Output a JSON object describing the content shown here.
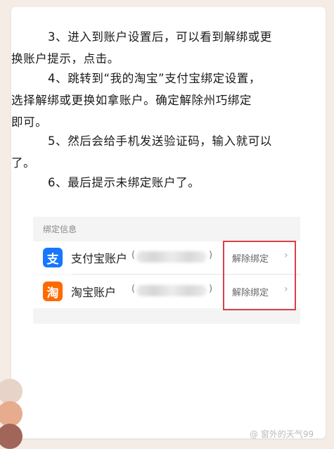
{
  "steps": {
    "s3_line1": "3、进入到账户设置后，可以看到解绑或更",
    "s3_line2": "换账户提示，点击。",
    "s4_line1": "4、跳转到“我的淘宝”支付宝绑定设置，",
    "s4_line2": "选择解绑或更换如拿账户。确定解除州巧绑定",
    "s4_line3": "即可。",
    "s5_line1": "5、然后会给手机发送验证码，输入就可以",
    "s5_line2": "了。",
    "s6_line1": "6、最后提示未绑定账户了。"
  },
  "screenshot": {
    "section_title": "绑定信息",
    "rows": [
      {
        "icon": "alipay-icon",
        "icon_glyph": "支",
        "icon_color": "#1677ff",
        "label": "支付宝账户",
        "unbind": "解除绑定"
      },
      {
        "icon": "taobao-icon",
        "icon_glyph": "淘",
        "icon_color": "#ff6a00",
        "label": "淘宝账户",
        "unbind": "解除绑定"
      }
    ],
    "highlight_color": "#d9404a"
  },
  "decoration_colors": [
    "#e7d3c8",
    "#e7ab8e",
    "#a1655a"
  ],
  "watermark": "@ 窗外的天气99"
}
